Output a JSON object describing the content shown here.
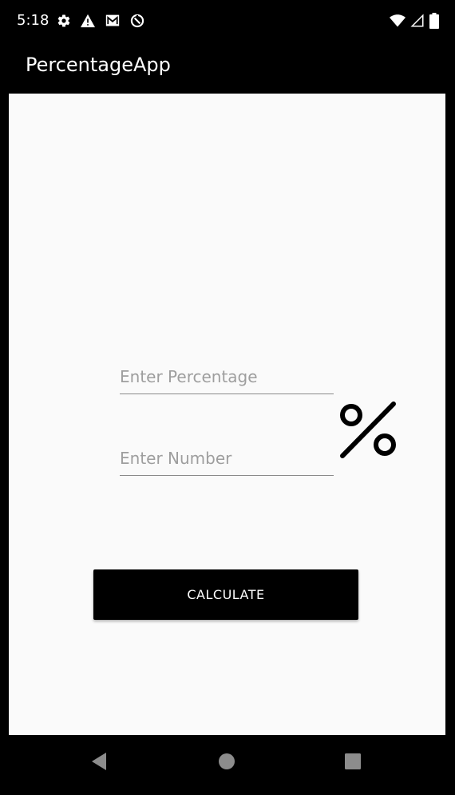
{
  "status_bar": {
    "time": "5:18",
    "left_icons": [
      "settings-icon",
      "warning-icon",
      "gmail-icon",
      "data-saver-icon"
    ],
    "right_icons": [
      "wifi-icon",
      "cell-signal-icon",
      "battery-icon"
    ]
  },
  "app_bar": {
    "title": "PercentageApp"
  },
  "form": {
    "percentage_placeholder": "Enter Percentage",
    "percentage_value": "",
    "number_placeholder": "Enter Number",
    "number_value": "",
    "percent_icon": "percent-icon",
    "calculate_label": "CALCULATE"
  },
  "nav_bar": {
    "buttons": [
      "back-icon",
      "home-icon",
      "recents-icon"
    ]
  },
  "colors": {
    "bar_background": "#000000",
    "content_background": "#fafafa",
    "button_background": "#000000",
    "button_text": "#ffffff",
    "hint_text": "#9e9e9e"
  }
}
